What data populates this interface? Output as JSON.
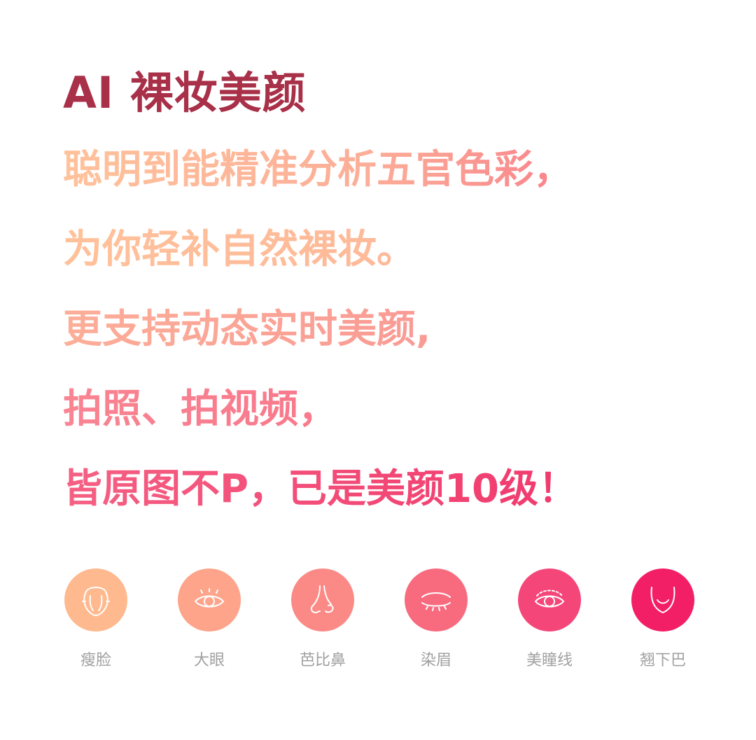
{
  "headline": "AI 裸妆美颜",
  "lines": [
    "聪明到能精准分析五官色彩，",
    "为你轻补自然裸妆。",
    "更支持动态实时美颜,",
    "拍照、拍视频，",
    "皆原图不P，已是美颜10级！"
  ],
  "features": [
    {
      "label": "瘦脸",
      "icon": "face-outline-icon",
      "color": "#ffb98f"
    },
    {
      "label": "大眼",
      "icon": "eye-icon",
      "color": "#fda48b"
    },
    {
      "label": "芭比鼻",
      "icon": "nose-icon",
      "color": "#fb8a86"
    },
    {
      "label": "染眉",
      "icon": "closed-eye-icon",
      "color": "#f86a7e"
    },
    {
      "label": "美瞳线",
      "icon": "eyeliner-icon",
      "color": "#f5467a"
    },
    {
      "label": "翘下巴",
      "icon": "chin-icon",
      "color": "#f31f66"
    }
  ],
  "colors": {
    "headline": "#a83048",
    "gradient_start": "#ffc39a",
    "gradient_end": "#f0245f",
    "label_gray": "#a0a0a0"
  }
}
